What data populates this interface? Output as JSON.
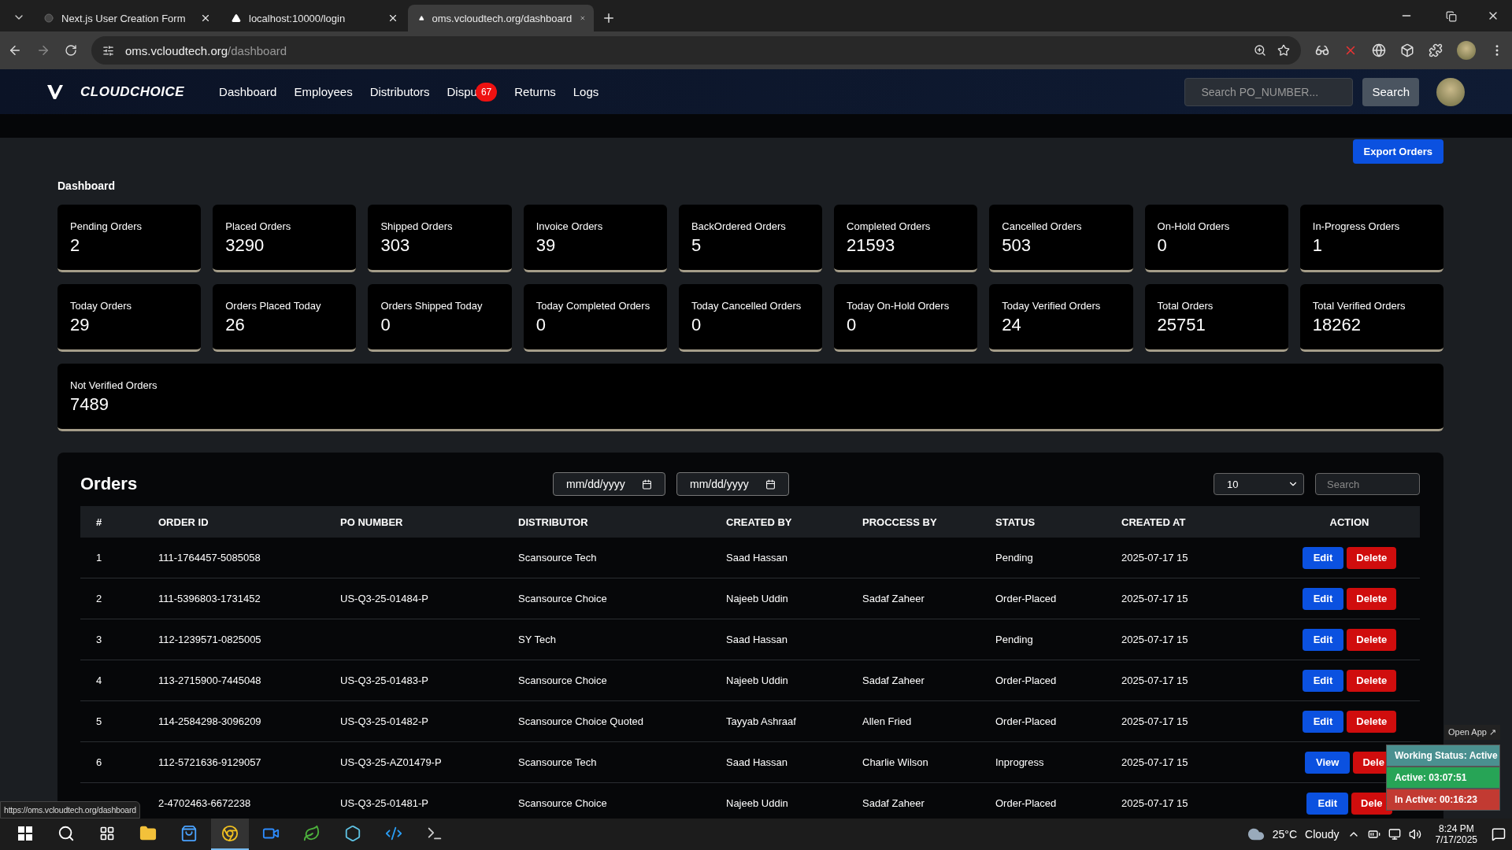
{
  "browser": {
    "tabs": [
      {
        "title": "Next.js User Creation Form",
        "selected": false
      },
      {
        "title": "localhost:10000/login",
        "selected": false
      },
      {
        "title": "oms.vcloudtech.org/dashboard",
        "selected": true
      }
    ],
    "url": {
      "host": "oms.vcloudtech.org",
      "path": "/dashboard"
    }
  },
  "nav": {
    "brand": "CLOUDCHOICE",
    "links": [
      {
        "label": "Dashboard"
      },
      {
        "label": "Employees"
      },
      {
        "label": "Distributors"
      },
      {
        "label": "Dispu",
        "badge": "67"
      },
      {
        "label": "Returns"
      },
      {
        "label": "Logs"
      }
    ],
    "search": {
      "placeholder": "Search PO_NUMBER..."
    },
    "search_button": "Search"
  },
  "export_button": "Export Orders",
  "dashboard": {
    "title": "Dashboard",
    "cards": [
      {
        "kind": "stat",
        "label": "Pending Orders",
        "value": "2"
      },
      {
        "kind": "stat",
        "label": "Placed Orders",
        "value": "3290"
      },
      {
        "kind": "stat",
        "label": "Shipped Orders",
        "value": "303"
      },
      {
        "kind": "stat",
        "label": "Invoice Orders",
        "value": "39"
      },
      {
        "kind": "stat",
        "label": "BackOrdered Orders",
        "value": "5"
      },
      {
        "kind": "stat",
        "label": "Completed Orders",
        "value": "21593"
      },
      {
        "kind": "stat",
        "label": "Cancelled Orders",
        "value": "503"
      },
      {
        "kind": "stat",
        "label": "On-Hold Orders",
        "value": "0"
      },
      {
        "kind": "stat",
        "label": "In-Progress Orders",
        "value": "1"
      },
      {
        "kind": "stat",
        "label": "Today Orders",
        "value": "29"
      },
      {
        "kind": "stat",
        "label": "Orders Placed Today",
        "value": "26"
      },
      {
        "kind": "stat",
        "label": "Orders Shipped Today",
        "value": "0"
      },
      {
        "kind": "stat",
        "label": "Today Completed Orders",
        "value": "0"
      },
      {
        "kind": "stat",
        "label": "Today Cancelled Orders",
        "value": "0"
      },
      {
        "kind": "stat",
        "label": "Today On-Hold Orders",
        "value": "0"
      },
      {
        "kind": "stat",
        "label": "Today Verified Orders",
        "value": "24"
      },
      {
        "kind": "stat",
        "label": "Total Orders",
        "value": "25751"
      },
      {
        "kind": "stat",
        "label": "Total Verified Orders",
        "value": "18262"
      },
      {
        "kind": "wide",
        "label": "Not Verified Orders",
        "value": "7489"
      }
    ]
  },
  "orders": {
    "title": "Orders",
    "date_from": {
      "placeholder": "mm/dd/yyyy"
    },
    "date_to": {
      "placeholder": "mm/dd/yyyy"
    },
    "page_size": "10",
    "search": {
      "placeholder": "Search"
    },
    "columns": [
      "#",
      "ORDER ID",
      "PO NUMBER",
      "DISTRIBUTOR",
      "CREATED BY",
      "PROCCESS BY",
      "STATUS",
      "CREATED AT",
      "ACTION"
    ],
    "rows": [
      {
        "cells": [
          "1",
          "111-1764457-5085058",
          "",
          "Scansource Tech",
          "Saad Hassan",
          "",
          "Pending",
          "2025-07-17 15"
        ],
        "actions": [
          {
            "kind": "edit",
            "label": "Edit"
          },
          {
            "kind": "delete",
            "label": "Delete"
          }
        ]
      },
      {
        "cells": [
          "2",
          "111-5396803-1731452",
          "US-Q3-25-01484-P",
          "Scansource Choice",
          "Najeeb Uddin",
          "Sadaf Zaheer",
          "Order-Placed",
          "2025-07-17 15"
        ],
        "actions": [
          {
            "kind": "edit",
            "label": "Edit"
          },
          {
            "kind": "delete",
            "label": "Delete"
          }
        ]
      },
      {
        "cells": [
          "3",
          "112-1239571-0825005",
          "",
          "SY Tech",
          "Saad Hassan",
          "",
          "Pending",
          "2025-07-17 15"
        ],
        "actions": [
          {
            "kind": "edit",
            "label": "Edit"
          },
          {
            "kind": "delete",
            "label": "Delete"
          }
        ]
      },
      {
        "cells": [
          "4",
          "113-2715900-7445048",
          "US-Q3-25-01483-P",
          "Scansource Choice",
          "Najeeb Uddin",
          "Sadaf Zaheer",
          "Order-Placed",
          "2025-07-17 15"
        ],
        "actions": [
          {
            "kind": "edit",
            "label": "Edit"
          },
          {
            "kind": "delete",
            "label": "Delete"
          }
        ]
      },
      {
        "cells": [
          "5",
          "114-2584298-3096209",
          "US-Q3-25-01482-P",
          "Scansource Choice Quoted",
          "Tayyab Ashraaf",
          "Allen Fried",
          "Order-Placed",
          "2025-07-17 15"
        ],
        "actions": [
          {
            "kind": "edit",
            "label": "Edit"
          },
          {
            "kind": "delete",
            "label": "Delete"
          }
        ]
      },
      {
        "cells": [
          "6",
          "112-5721636-9129057",
          "US-Q3-25-AZ01479-P",
          "Scansource Tech",
          "Saad Hassan",
          "Charlie Wilson",
          "Inprogress",
          "2025-07-17 15"
        ],
        "actions": [
          {
            "kind": "view",
            "label": "View"
          },
          {
            "kind": "delete",
            "label": "Dele"
          }
        ]
      },
      {
        "cells": [
          "",
          "2-4702463-6672238",
          "US-Q3-25-01481-P",
          "Scansource Choice",
          "Najeeb Uddin",
          "Sadaf Zaheer",
          "Order-Placed",
          "2025-07-17 15"
        ],
        "actions": [
          {
            "kind": "edit",
            "label": "Edit"
          },
          {
            "kind": "delete",
            "label": "Dele"
          }
        ]
      }
    ]
  },
  "status_bubble": "https://oms.vcloudtech.org/dashboard",
  "work_panel": {
    "open_app": "Open App ↗",
    "items": [
      {
        "label": "Working Status: Active",
        "color": "#4a9090"
      },
      {
        "label": "Active: 03:07:51",
        "color": "#27a456"
      },
      {
        "label": "In Active: 00:16:23",
        "color": "#c23a32"
      }
    ]
  },
  "taskbar": {
    "apps": [
      {
        "kind": "explorer",
        "selected": false
      },
      {
        "kind": "store",
        "selected": false
      },
      {
        "kind": "chrome",
        "selected": true
      },
      {
        "kind": "zoom",
        "selected": false
      },
      {
        "kind": "leaf",
        "selected": false
      },
      {
        "kind": "hexagon",
        "selected": false
      },
      {
        "kind": "code",
        "selected": false
      },
      {
        "kind": "terminal",
        "selected": false
      }
    ],
    "weather": {
      "temp": "25°C",
      "condition": "Cloudy"
    },
    "time": "8:24 PM",
    "date": "7/17/2025"
  }
}
